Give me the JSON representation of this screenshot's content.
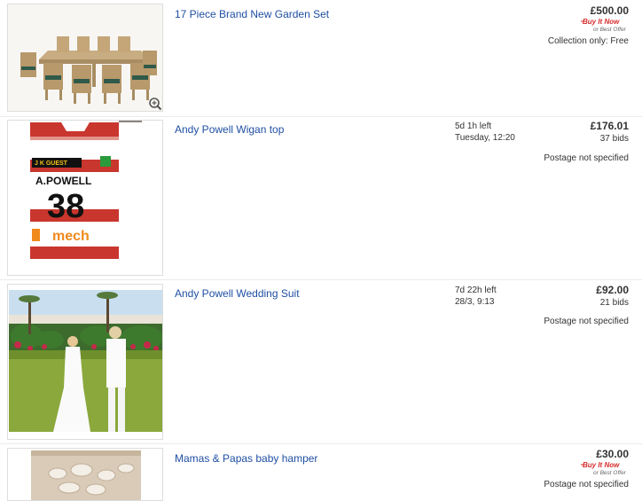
{
  "listings": [
    {
      "title": "17 Piece Brand New Garden Set",
      "price": "£500.00",
      "buy_it_now_logo": "Buy It Now or Best Offer",
      "shipping": "Collection only: Free",
      "thumbnail_icon": "garden-furniture-photo"
    },
    {
      "title": "Andy Powell Wigan top",
      "time_left": "5d 1h left",
      "end_time": "Tuesday, 12:20",
      "price": "£176.01",
      "bids": "37 bids",
      "shipping": "Postage not specified",
      "thumbnail_icon": "rugby-shirt-photo",
      "shirt_sponsor": "J K GUEST",
      "shirt_name": "A.POWELL",
      "shirt_number": "38",
      "shirt_logo": "mech"
    },
    {
      "title": "Andy Powell Wedding Suit",
      "time_left": "7d 22h left",
      "end_time": "28/3, 9:13",
      "price": "£92.00",
      "bids": "21 bids",
      "shipping": "Postage not specified",
      "thumbnail_icon": "wedding-photo"
    },
    {
      "title": "Mamas & Papas baby hamper",
      "price": "£30.00",
      "buy_it_now_logo": "Buy It Now or Best Offer",
      "shipping": "Postage not specified",
      "thumbnail_icon": "baby-hamper-photo"
    }
  ],
  "colors": {
    "link": "#1f4fa3",
    "bin_red": "#d62b2b",
    "divider": "#ebebeb"
  }
}
